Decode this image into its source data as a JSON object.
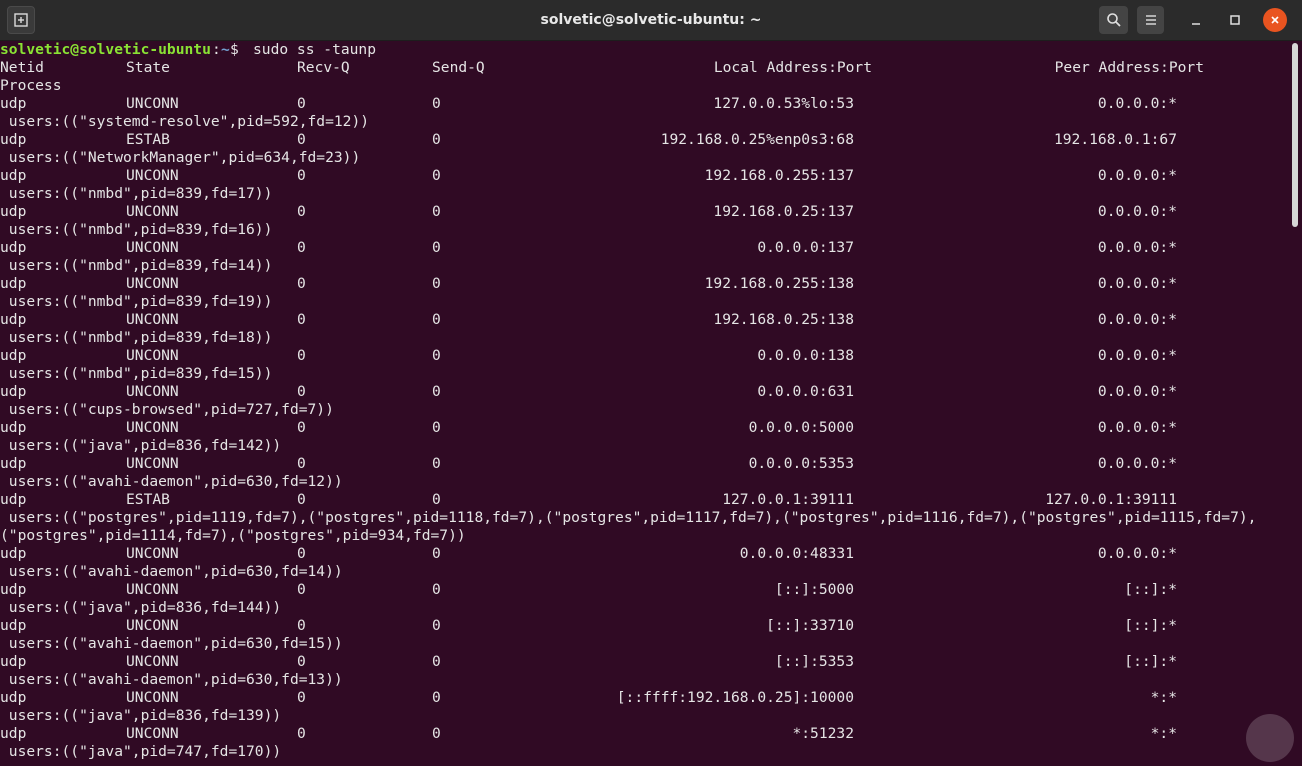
{
  "window": {
    "title": "solvetic@solvetic-ubuntu: ~"
  },
  "titlebar_icons": {
    "new_tab": "new-tab-icon",
    "search": "search-icon",
    "menu": "hamburger-menu-icon",
    "minimize": "minimize-icon",
    "maximize": "maximize-icon",
    "close": "close-icon"
  },
  "colors": {
    "background": "#300a24",
    "titlebar": "#2b2b2b",
    "prompt_user": "#8ae234",
    "prompt_path": "#729fcf",
    "close_button": "#e95420",
    "text": "#e5e5e5"
  },
  "prompt": {
    "user_host": "solvetic@solvetic-ubuntu",
    "sep": ":",
    "path": "~",
    "symbol": "$ ",
    "command": "sudo ss -taunp"
  },
  "header": {
    "netid": "Netid",
    "state": "State",
    "recvq": "Recv-Q",
    "sendq": "Send-Q",
    "local": "Local Address:Port",
    "peer": "Peer Address:Port",
    "process": "Process"
  },
  "rows": [
    {
      "netid": "udp",
      "state": "UNCONN",
      "recvq": "0",
      "sendq": "0",
      "local": "127.0.0.53%lo:53",
      "peer": "0.0.0.0:*",
      "process": " users:((\"systemd-resolve\",pid=592,fd=12))"
    },
    {
      "netid": "udp",
      "state": "ESTAB",
      "recvq": "0",
      "sendq": "0",
      "local": "192.168.0.25%enp0s3:68",
      "peer": "192.168.0.1:67",
      "process": " users:((\"NetworkManager\",pid=634,fd=23))"
    },
    {
      "netid": "udp",
      "state": "UNCONN",
      "recvq": "0",
      "sendq": "0",
      "local": "192.168.0.255:137",
      "peer": "0.0.0.0:*",
      "process": " users:((\"nmbd\",pid=839,fd=17))"
    },
    {
      "netid": "udp",
      "state": "UNCONN",
      "recvq": "0",
      "sendq": "0",
      "local": "192.168.0.25:137",
      "peer": "0.0.0.0:*",
      "process": " users:((\"nmbd\",pid=839,fd=16))"
    },
    {
      "netid": "udp",
      "state": "UNCONN",
      "recvq": "0",
      "sendq": "0",
      "local": "0.0.0.0:137",
      "peer": "0.0.0.0:*",
      "process": " users:((\"nmbd\",pid=839,fd=14))"
    },
    {
      "netid": "udp",
      "state": "UNCONN",
      "recvq": "0",
      "sendq": "0",
      "local": "192.168.0.255:138",
      "peer": "0.0.0.0:*",
      "process": " users:((\"nmbd\",pid=839,fd=19))"
    },
    {
      "netid": "udp",
      "state": "UNCONN",
      "recvq": "0",
      "sendq": "0",
      "local": "192.168.0.25:138",
      "peer": "0.0.0.0:*",
      "process": " users:((\"nmbd\",pid=839,fd=18))"
    },
    {
      "netid": "udp",
      "state": "UNCONN",
      "recvq": "0",
      "sendq": "0",
      "local": "0.0.0.0:138",
      "peer": "0.0.0.0:*",
      "process": " users:((\"nmbd\",pid=839,fd=15))"
    },
    {
      "netid": "udp",
      "state": "UNCONN",
      "recvq": "0",
      "sendq": "0",
      "local": "0.0.0.0:631",
      "peer": "0.0.0.0:*",
      "process": " users:((\"cups-browsed\",pid=727,fd=7))"
    },
    {
      "netid": "udp",
      "state": "UNCONN",
      "recvq": "0",
      "sendq": "0",
      "local": "0.0.0.0:5000",
      "peer": "0.0.0.0:*",
      "process": " users:((\"java\",pid=836,fd=142))"
    },
    {
      "netid": "udp",
      "state": "UNCONN",
      "recvq": "0",
      "sendq": "0",
      "local": "0.0.0.0:5353",
      "peer": "0.0.0.0:*",
      "process": " users:((\"avahi-daemon\",pid=630,fd=12))"
    },
    {
      "netid": "udp",
      "state": "ESTAB",
      "recvq": "0",
      "sendq": "0",
      "local": "127.0.0.1:39111",
      "peer": "127.0.0.1:39111",
      "process": " users:((\"postgres\",pid=1119,fd=7),(\"postgres\",pid=1118,fd=7),(\"postgres\",pid=1117,fd=7),(\"postgres\",pid=1116,fd=7),(\"postgres\",pid=1115,fd=7),",
      "process2": "(\"postgres\",pid=1114,fd=7),(\"postgres\",pid=934,fd=7))"
    },
    {
      "netid": "udp",
      "state": "UNCONN",
      "recvq": "0",
      "sendq": "0",
      "local": "0.0.0.0:48331",
      "peer": "0.0.0.0:*",
      "process": " users:((\"avahi-daemon\",pid=630,fd=14))"
    },
    {
      "netid": "udp",
      "state": "UNCONN",
      "recvq": "0",
      "sendq": "0",
      "local": "[::]:5000",
      "peer": "[::]:*",
      "process": " users:((\"java\",pid=836,fd=144))"
    },
    {
      "netid": "udp",
      "state": "UNCONN",
      "recvq": "0",
      "sendq": "0",
      "local": "[::]:33710",
      "peer": "[::]:*",
      "process": " users:((\"avahi-daemon\",pid=630,fd=15))"
    },
    {
      "netid": "udp",
      "state": "UNCONN",
      "recvq": "0",
      "sendq": "0",
      "local": "[::]:5353",
      "peer": "[::]:*",
      "process": " users:((\"avahi-daemon\",pid=630,fd=13))"
    },
    {
      "netid": "udp",
      "state": "UNCONN",
      "recvq": "0",
      "sendq": "0",
      "local": "[::ffff:192.168.0.25]:10000",
      "peer": "*:*",
      "process": " users:((\"java\",pid=836,fd=139))"
    },
    {
      "netid": "udp",
      "state": "UNCONN",
      "recvq": "0",
      "sendq": "0",
      "local": "*:51232",
      "peer": "*:*",
      "process": " users:((\"java\",pid=747,fd=170))"
    }
  ]
}
